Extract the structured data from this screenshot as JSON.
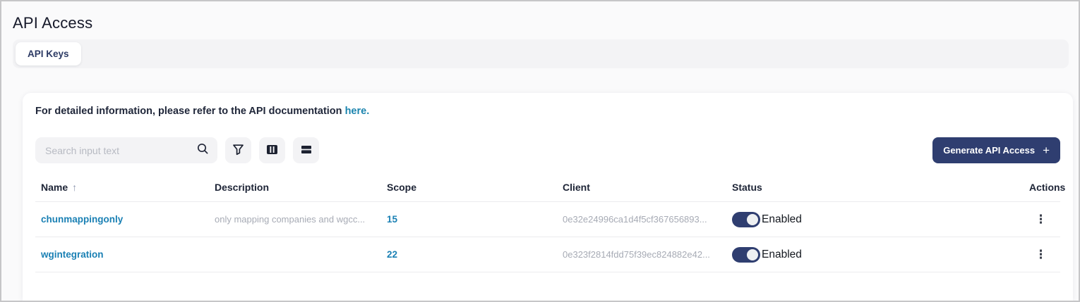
{
  "page": {
    "title": "API Access"
  },
  "tabs": [
    {
      "label": "API Keys",
      "active": true
    }
  ],
  "info": {
    "text": "For detailed information, please refer to the API documentation",
    "link_label": "here."
  },
  "toolbar": {
    "search_placeholder": "Search input text",
    "search_icon": "search-icon",
    "filter_icon": "filter-icon",
    "columns_icon": "columns-icon",
    "density_icon": "density-icon",
    "generate_button_label": "Generate API Access",
    "generate_button_plus": "+"
  },
  "table": {
    "columns": [
      {
        "key": "name",
        "label": "Name",
        "sorted": "asc",
        "sort_glyph": "↑"
      },
      {
        "key": "desc",
        "label": "Description"
      },
      {
        "key": "scope",
        "label": "Scope"
      },
      {
        "key": "client",
        "label": "Client"
      },
      {
        "key": "status",
        "label": "Status"
      },
      {
        "key": "actions",
        "label": "Actions"
      }
    ],
    "rows": [
      {
        "name": "chunmappingonly",
        "description": "only mapping companies and wgcc...",
        "scope": "15",
        "client": "0e32e24996ca1d4f5cf367656893...",
        "status_label": "Enabled",
        "status_on": true
      },
      {
        "name": "wgintegration",
        "description": "",
        "scope": "22",
        "client": "0e323f2814fdd75f39ec824882e42...",
        "status_label": "Enabled",
        "status_on": true
      }
    ],
    "kebab_glyph": "⋮"
  },
  "colors": {
    "accent_navy": "#2f3e70",
    "link_blue": "#1a80b4",
    "muted_text": "#a7abb5",
    "header_text": "#1d2436",
    "card_bg": "#ffffff",
    "page_bg": "#fafafb",
    "control_bg": "#f3f3f5"
  }
}
